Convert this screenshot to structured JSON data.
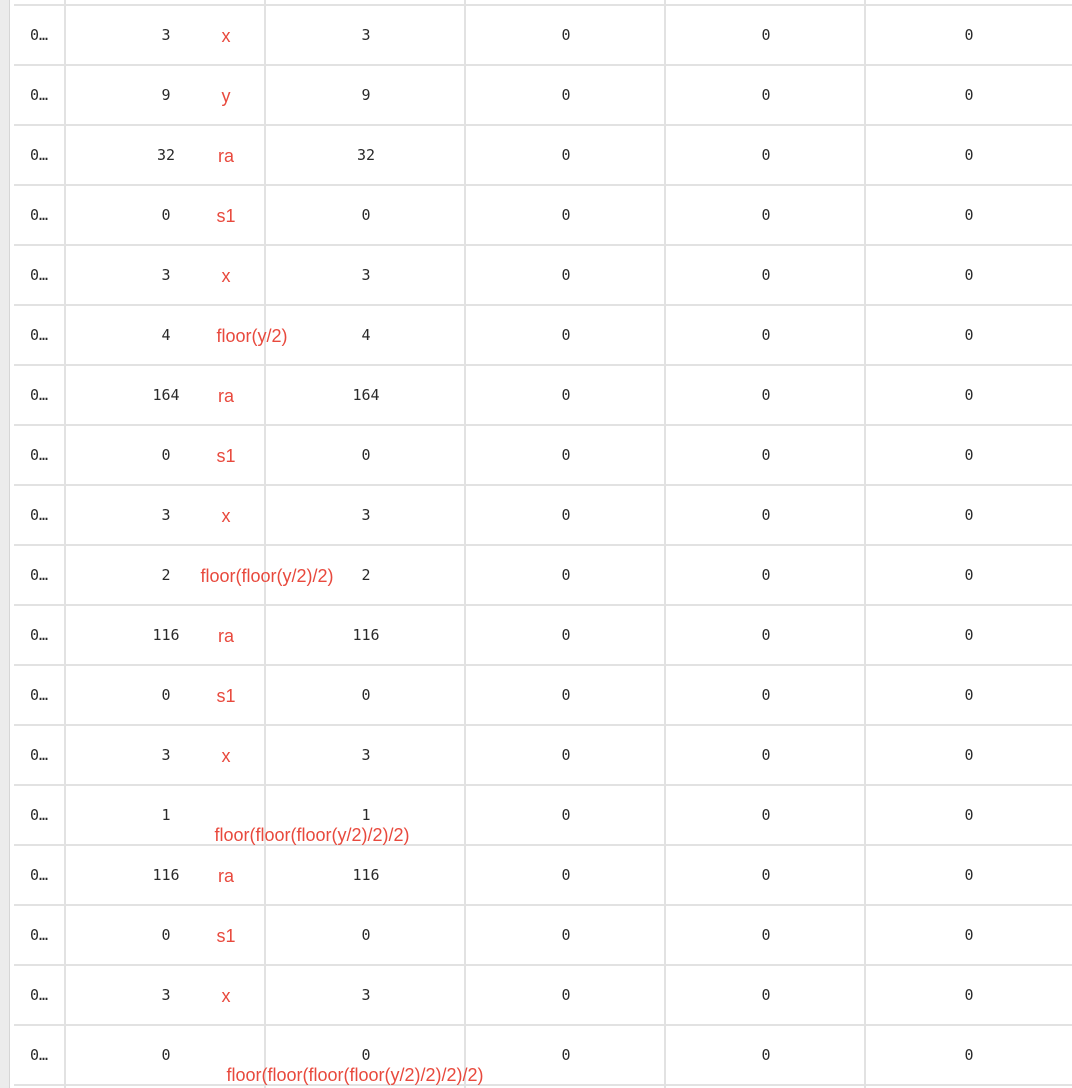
{
  "table": {
    "rows": [
      {
        "addr": "0…",
        "val1": "3",
        "annot": "x",
        "val2": "3",
        "a": "0",
        "b": "0",
        "c": "0"
      },
      {
        "addr": "0…",
        "val1": "9",
        "annot": "y",
        "val2": "9",
        "a": "0",
        "b": "0",
        "c": "0"
      },
      {
        "addr": "0…",
        "val1": "32",
        "annot": "ra",
        "val2": "32",
        "a": "0",
        "b": "0",
        "c": "0"
      },
      {
        "addr": "0…",
        "val1": "0",
        "annot": "s1",
        "val2": "0",
        "a": "0",
        "b": "0",
        "c": "0"
      },
      {
        "addr": "0…",
        "val1": "3",
        "annot": "x",
        "val2": "3",
        "a": "0",
        "b": "0",
        "c": "0"
      },
      {
        "addr": "0…",
        "val1": "4",
        "annot": "floor(y/2)",
        "val2": "4",
        "a": "0",
        "b": "0",
        "c": "0"
      },
      {
        "addr": "0…",
        "val1": "164",
        "annot": "ra",
        "val2": "164",
        "a": "0",
        "b": "0",
        "c": "0"
      },
      {
        "addr": "0…",
        "val1": "0",
        "annot": "s1",
        "val2": "0",
        "a": "0",
        "b": "0",
        "c": "0"
      },
      {
        "addr": "0…",
        "val1": "3",
        "annot": "x",
        "val2": "3",
        "a": "0",
        "b": "0",
        "c": "0"
      },
      {
        "addr": "0…",
        "val1": "2",
        "annot": "floor(floor(y/2)/2)",
        "val2": "2",
        "a": "0",
        "b": "0",
        "c": "0"
      },
      {
        "addr": "0…",
        "val1": "116",
        "annot": "ra",
        "val2": "116",
        "a": "0",
        "b": "0",
        "c": "0"
      },
      {
        "addr": "0…",
        "val1": "0",
        "annot": "s1",
        "val2": "0",
        "a": "0",
        "b": "0",
        "c": "0"
      },
      {
        "addr": "0…",
        "val1": "3",
        "annot": "x",
        "val2": "3",
        "a": "0",
        "b": "0",
        "c": "0"
      },
      {
        "addr": "0…",
        "val1": "1",
        "annot": "floor(floor(floor(y/2)/2)/2)",
        "val2": "1",
        "a": "0",
        "b": "0",
        "c": "0"
      },
      {
        "addr": "0…",
        "val1": "116",
        "annot": "ra",
        "val2": "116",
        "a": "0",
        "b": "0",
        "c": "0"
      },
      {
        "addr": "0…",
        "val1": "0",
        "annot": "s1",
        "val2": "0",
        "a": "0",
        "b": "0",
        "c": "0"
      },
      {
        "addr": "0…",
        "val1": "3",
        "annot": "x",
        "val2": "3",
        "a": "0",
        "b": "0",
        "c": "0"
      },
      {
        "addr": "0…",
        "val1": "0",
        "annot": "floor(floor(floor(floor(y/2)/2)/2)/2)",
        "val2": "0",
        "a": "0",
        "b": "0",
        "c": "0"
      }
    ]
  },
  "colors": {
    "annotation": "#e8493d",
    "grid_line": "#e2e2e2",
    "text": "#2a2a2a"
  }
}
